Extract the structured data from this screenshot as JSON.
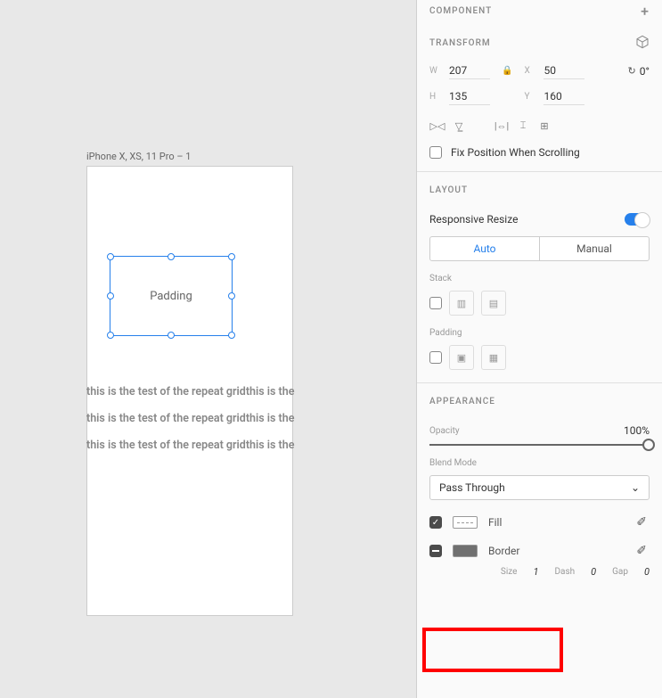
{
  "artboard": {
    "label": "iPhone X, XS, 11 Pro – 1"
  },
  "selection": {
    "label": "Padding"
  },
  "repeat_text": "this is the test of the repeat gridthis is the",
  "panel": {
    "component": {
      "title": "COMPONENT"
    },
    "transform": {
      "title": "TRANSFORM",
      "w_label": "W",
      "w": "207",
      "x_label": "X",
      "x": "50",
      "h_label": "H",
      "h": "135",
      "y_label": "Y",
      "y": "160",
      "rotation": "0°"
    },
    "fix_position": "Fix Position When Scrolling",
    "layout": {
      "title": "LAYOUT",
      "responsive": "Responsive Resize",
      "auto": "Auto",
      "manual": "Manual",
      "stack": "Stack",
      "padding": "Padding"
    },
    "appearance": {
      "title": "APPEARANCE",
      "opacity_label": "Opacity",
      "opacity_value": "100%",
      "blend_label": "Blend Mode",
      "blend_value": "Pass Through",
      "fill": "Fill",
      "border": "Border",
      "size_label": "Size",
      "size_val": "1",
      "dash_label": "Dash",
      "dash_val": "0",
      "gap_label": "Gap",
      "gap_val": "0"
    }
  }
}
